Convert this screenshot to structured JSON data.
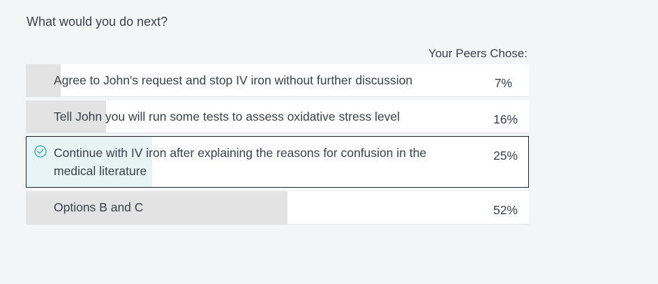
{
  "question": "What would you do next?",
  "peers_label": "Your Peers Chose:",
  "accent_color": "#3bb3b8",
  "options": [
    {
      "label": "Agree to John's request and stop IV iron without further discussion",
      "percent_text": "7%",
      "percent": 7,
      "selected": false
    },
    {
      "label": "Tell John you will run some tests to assess oxidative stress level",
      "percent_text": "16%",
      "percent": 16,
      "selected": false
    },
    {
      "label": "Continue with IV iron after explaining the reasons for confusion in the medical literature",
      "percent_text": "25%",
      "percent": 25,
      "selected": true,
      "icon": "check-circle-icon"
    },
    {
      "label": "Options B and C",
      "percent_text": "52%",
      "percent": 52,
      "selected": false
    }
  ]
}
